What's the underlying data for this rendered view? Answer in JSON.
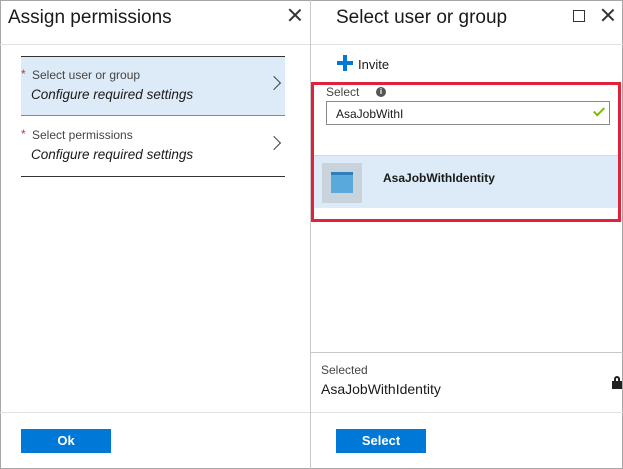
{
  "left_blade": {
    "title": "Assign permissions",
    "steps": [
      {
        "required": "*",
        "label": "Select user or group",
        "status": "Configure required settings"
      },
      {
        "required": "*",
        "label": "Select permissions",
        "status": "Configure required settings"
      }
    ],
    "ok_label": "Ok"
  },
  "right_blade": {
    "title": "Select user or group",
    "invite_label": "Invite",
    "select_label": "Select",
    "search_value": "AsaJobWithI",
    "results": [
      {
        "name": "AsaJobWithIdentity"
      }
    ],
    "selected_label": "Selected",
    "selected_value": "AsaJobWithIdentity",
    "select_button": "Select"
  },
  "colors": {
    "accent": "#0078d7",
    "highlight_border": "#e0223b",
    "selected_bg": "#dcebf7",
    "check_green": "#7fba00"
  }
}
